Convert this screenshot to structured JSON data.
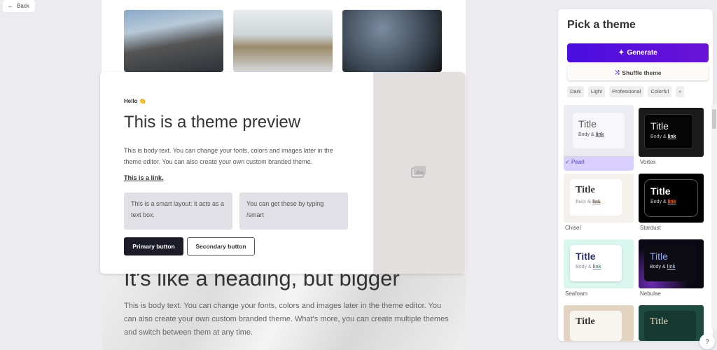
{
  "back_label": "Back",
  "preview": {
    "hello": "Hello 👏",
    "title": "This is a theme preview",
    "body": "This is body text. You can change your fonts, colors and images later in the theme editor. You can also create your own custom branded theme.",
    "link": "This is a link.",
    "smart_box_1": "This is a smart layout: it acts as a text box.",
    "smart_box_2": "You can get these by typing /smart",
    "primary_button": "Primary button",
    "secondary_button": "Secondary button"
  },
  "doc": {
    "heading": "It's like a heading, but bigger",
    "body": "This is body text. You can change your fonts, colors and images later in the theme editor. You can also create your own custom branded theme. What's more, you can create multiple themes and switch between them at any time."
  },
  "panel": {
    "title": "Pick a theme",
    "generate": "Generate",
    "shuffle": "Shuffle theme",
    "tags": [
      "Dark",
      "Light",
      "Professional",
      "Colorful"
    ],
    "themes": [
      {
        "name": "Pearl",
        "title": "Title",
        "body": "Body & ",
        "link": "link",
        "selected": true
      },
      {
        "name": "Vortex",
        "title": "Title",
        "body": "Body & ",
        "link": "link"
      },
      {
        "name": "Chisel",
        "title": "Title",
        "body": "Body & ",
        "link": "link"
      },
      {
        "name": "Stardust",
        "title": "Title",
        "body": "Body & ",
        "link": "link"
      },
      {
        "name": "Seafoam",
        "title": "Title",
        "body": "Body & ",
        "link": "link"
      },
      {
        "name": "Nebulae",
        "title": "Title",
        "body": "Body & ",
        "link": "link"
      },
      {
        "name": "",
        "title": "Title"
      },
      {
        "name": "",
        "title": "Title"
      }
    ]
  },
  "help": "?"
}
